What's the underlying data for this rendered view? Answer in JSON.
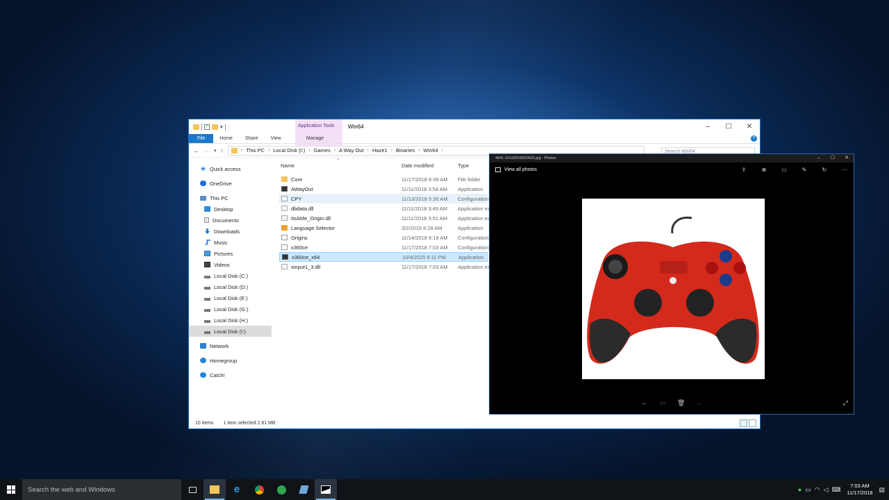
{
  "explorer": {
    "window_title": "Win64",
    "context_tab": "Application Tools",
    "ribbon_tabs": [
      "File",
      "Home",
      "Share",
      "View"
    ],
    "manage_tab": "Manage",
    "breadcrumb": [
      "This PC",
      "Local Disk (I:)",
      "Games",
      "A Way Out",
      "Haze1",
      "Binaries",
      "Win64"
    ],
    "search_placeholder": "Search Win64",
    "columns": {
      "name": "Name",
      "date": "Date modified",
      "type": "Type"
    },
    "tree": [
      {
        "label": "Quick access",
        "icon": "star-icon"
      },
      {
        "label": "OneDrive",
        "icon": "cloud-icon"
      },
      {
        "label": "This PC",
        "icon": "pc-icon"
      },
      {
        "label": "Desktop",
        "icon": "desktop-icon"
      },
      {
        "label": "Documents",
        "icon": "documents-icon"
      },
      {
        "label": "Downloads",
        "icon": "download-icon"
      },
      {
        "label": "Music",
        "icon": "music-icon"
      },
      {
        "label": "Pictures",
        "icon": "pictures-icon"
      },
      {
        "label": "Videos",
        "icon": "videos-icon"
      },
      {
        "label": "Local Disk (C:)",
        "icon": "drive-icon"
      },
      {
        "label": "Local Disk (D:)",
        "icon": "drive-icon"
      },
      {
        "label": "Local Disk (E:)",
        "icon": "drive-icon"
      },
      {
        "label": "Local Disk (G:)",
        "icon": "drive-icon"
      },
      {
        "label": "Local Disk (H:)",
        "icon": "drive-icon"
      },
      {
        "label": "Local Disk (I:)",
        "icon": "drive-icon"
      },
      {
        "label": "Network",
        "icon": "network-icon"
      },
      {
        "label": "Homegroup",
        "icon": "homegroup-icon"
      },
      {
        "label": "Catch!",
        "icon": "catch-icon"
      }
    ],
    "files": [
      {
        "name": "Core",
        "date": "11/17/2018 6:39 AM",
        "type": "File folder"
      },
      {
        "name": "AWayOut",
        "date": "11/11/2018 3:54 AM",
        "type": "Application"
      },
      {
        "name": "CPY",
        "date": "11/13/2018 5:36 AM",
        "type": "Configuration"
      },
      {
        "name": "dbdata.dll",
        "date": "11/11/2018 3:49 AM",
        "type": "Application extension"
      },
      {
        "name": "ItsAMe_Origin.dll",
        "date": "11/11/2018 3:51 AM",
        "type": "Application extension"
      },
      {
        "name": "Language Selector",
        "date": "3/2/2015 6:28 AM",
        "type": "Application"
      },
      {
        "name": "Origins",
        "date": "11/14/2018 6:19 AM",
        "type": "Configuration"
      },
      {
        "name": "x360ce",
        "date": "11/17/2018 7:03 AM",
        "type": "Configuration"
      },
      {
        "name": "x360ce_x64",
        "date": "10/4/2015 6:11 PM",
        "type": "Application"
      },
      {
        "name": "xinput1_3.dll",
        "date": "11/17/2018 7:03 AM",
        "type": "Application extension"
      }
    ],
    "status": {
      "count": "10 items",
      "selected": "1 item selected  2.81 MB"
    }
  },
  "photos": {
    "title": "4941-15102016020601.jpg - Photos",
    "view_all": "View all photos"
  },
  "taskbar": {
    "search_placeholder": "Search the web and Windows",
    "time": "7:03 AM",
    "date": "11/17/2018"
  },
  "colors": {
    "accent": "#1979ca",
    "selection": "#cce8ff",
    "controller": "#d42a1c"
  }
}
